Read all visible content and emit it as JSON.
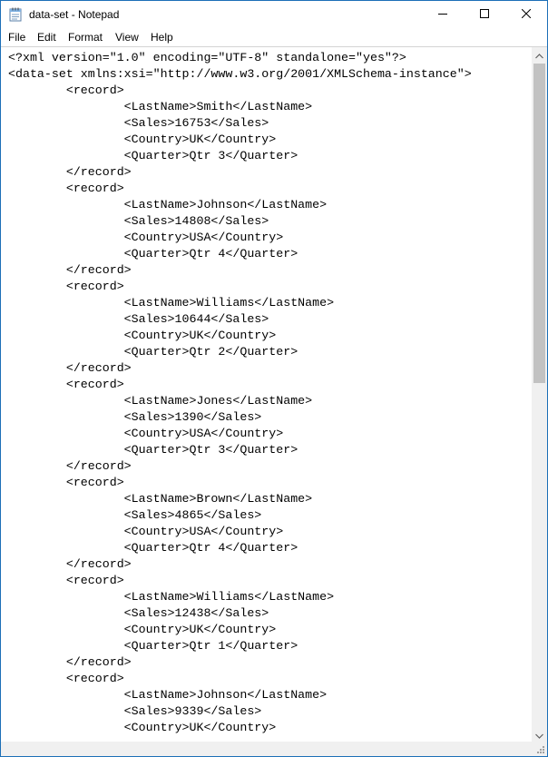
{
  "window": {
    "title": "data-set - Notepad"
  },
  "menu": {
    "items": [
      "File",
      "Edit",
      "Format",
      "View",
      "Help"
    ]
  },
  "document": {
    "lines": [
      "<?xml version=\"1.0\" encoding=\"UTF-8\" standalone=\"yes\"?>",
      "<data-set xmlns:xsi=\"http://www.w3.org/2001/XMLSchema-instance\">",
      "        <record>",
      "                <LastName>Smith</LastName>",
      "                <Sales>16753</Sales>",
      "                <Country>UK</Country>",
      "                <Quarter>Qtr 3</Quarter>",
      "        </record>",
      "        <record>",
      "                <LastName>Johnson</LastName>",
      "                <Sales>14808</Sales>",
      "                <Country>USA</Country>",
      "                <Quarter>Qtr 4</Quarter>",
      "        </record>",
      "        <record>",
      "                <LastName>Williams</LastName>",
      "                <Sales>10644</Sales>",
      "                <Country>UK</Country>",
      "                <Quarter>Qtr 2</Quarter>",
      "        </record>",
      "        <record>",
      "                <LastName>Jones</LastName>",
      "                <Sales>1390</Sales>",
      "                <Country>USA</Country>",
      "                <Quarter>Qtr 3</Quarter>",
      "        </record>",
      "        <record>",
      "                <LastName>Brown</LastName>",
      "                <Sales>4865</Sales>",
      "                <Country>USA</Country>",
      "                <Quarter>Qtr 4</Quarter>",
      "        </record>",
      "        <record>",
      "                <LastName>Williams</LastName>",
      "                <Sales>12438</Sales>",
      "                <Country>UK</Country>",
      "                <Quarter>Qtr 1</Quarter>",
      "        </record>",
      "        <record>",
      "                <LastName>Johnson</LastName>",
      "                <Sales>9339</Sales>",
      "                <Country>UK</Country>"
    ]
  },
  "icons": {
    "app": "notepad-icon",
    "minimize": "minimize-icon",
    "maximize": "maximize-icon",
    "close": "close-icon",
    "scroll_up": "chevron-up-icon",
    "scroll_down": "chevron-down-icon"
  },
  "colors": {
    "window_border": "#1c6fb7",
    "scrollbar_track": "#f0f0f0",
    "scrollbar_thumb": "#c2c2c2"
  },
  "scroll": {
    "vertical_position_fraction": 0.0
  }
}
